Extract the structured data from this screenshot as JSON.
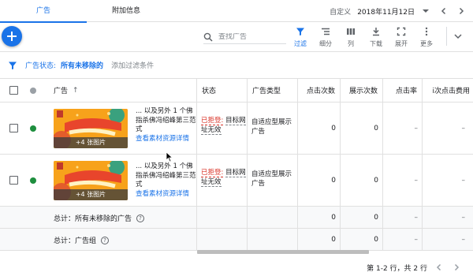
{
  "tabs": [
    {
      "label": "广告",
      "active": true
    },
    {
      "label": "附加信息",
      "active": false
    }
  ],
  "date": {
    "preset_label": "自定义",
    "value": "2018年11月12日"
  },
  "toolbar": {
    "search_placeholder": "查找广告",
    "tools": [
      {
        "label": "过滤",
        "icon": "filter-icon",
        "active": true
      },
      {
        "label": "细分",
        "icon": "segment-icon",
        "active": false
      },
      {
        "label": "列",
        "icon": "columns-icon",
        "active": false
      },
      {
        "label": "下载",
        "icon": "download-icon",
        "active": false
      },
      {
        "label": "展开",
        "icon": "expand-icon",
        "active": false
      },
      {
        "label": "更多",
        "icon": "more-vert-icon",
        "active": false
      }
    ]
  },
  "filter": {
    "label": "广告状态:",
    "value": "所有未移除的",
    "add_label": "添加过滤条件"
  },
  "table": {
    "columns": [
      "广告",
      "状态",
      "广告类型",
      "点击次数",
      "展示次数",
      "点击率",
      "i次点击费用"
    ],
    "sort_indicator": "↑",
    "rows": [
      {
        "thumb_caption": "+4 张图片",
        "ad_title": "... 以及另外 1 个佛指杀佛冯绍峰第三范式",
        "ad_link": "查看素材资源详情",
        "status_primary": "已拒登:",
        "status_secondary": "目标网址无效",
        "ad_type": "自适应型展示广告",
        "clicks": "0",
        "impressions": "0",
        "ctr": "–",
        "cpc": "–"
      },
      {
        "thumb_caption": "+4 张图片",
        "ad_title": "... 以及另外 1 个佛指杀佛冯绍峰第三范式",
        "ad_link": "查看素材资源详情",
        "status_primary": "已拒登:",
        "status_secondary": "目标网址无效",
        "ad_type": "自适应型展示广告",
        "clicks": "0",
        "impressions": "0",
        "ctr": "–",
        "cpc": "–"
      }
    ],
    "totals": [
      {
        "label": "总计：所有未移除的广告",
        "clicks": "0",
        "impressions": "0",
        "ctr": "–",
        "cpc": "–"
      },
      {
        "label": "总计：广告组",
        "clicks": "0",
        "impressions": "0",
        "ctr": "–",
        "cpc": "–"
      }
    ]
  },
  "pagination": {
    "text": "第 1-2 行，共 2 行"
  },
  "colors": {
    "accent": "#1a73e8",
    "status_enabled": "#1e8e3e",
    "status_disapproved": "#d93025"
  }
}
